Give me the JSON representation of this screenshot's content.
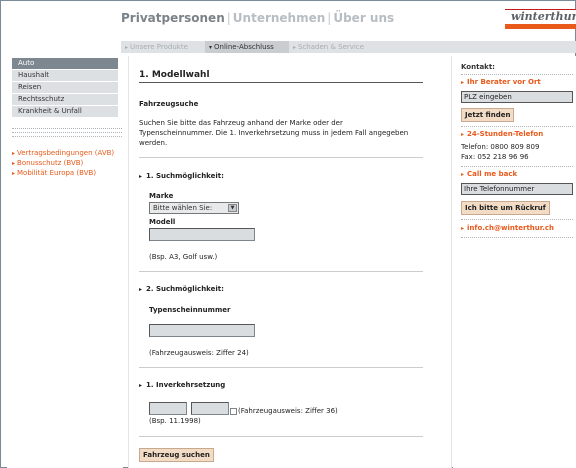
{
  "header": {
    "nav": [
      {
        "label": "Privatpersonen",
        "active": true
      },
      {
        "label": "Unternehmen",
        "active": false
      },
      {
        "label": "Über uns",
        "active": false
      }
    ],
    "separator": "|",
    "logo_text": "winterthur"
  },
  "subnav": {
    "tabs": [
      {
        "label": "Unsere Produkte",
        "active": false
      },
      {
        "label": "Online-Abschluss",
        "active": true
      },
      {
        "label": "Schaden & Service",
        "active": false
      }
    ]
  },
  "sidebar": {
    "items": [
      {
        "label": "Auto",
        "active": true
      },
      {
        "label": "Haushalt",
        "active": false
      },
      {
        "label": "Reisen",
        "active": false
      },
      {
        "label": "Rechtsschutz",
        "active": false
      },
      {
        "label": "Krankheit & Unfall",
        "active": false
      }
    ],
    "links": [
      {
        "label": "Vertragsbedingungen (AVB)"
      },
      {
        "label": "Bonusschutz (BVB)"
      },
      {
        "label": "Mobilität Europa (BVB)"
      }
    ]
  },
  "main": {
    "title": "1. Modellwahl",
    "subtitle": "Fahrzeugsuche",
    "intro": "Suchen Sie bitte das Fahrzeug anhand der Marke oder der Typenscheinnummer. Die 1. Inverkehrsetzung muss in jedem Fall angegeben werden.",
    "section1": {
      "heading": "1. Suchmöglichkeit:",
      "marke_label": "Marke",
      "marke_value": "Bitte wählen Sie:",
      "modell_label": "Modell",
      "modell_value": "",
      "example": "(Bsp. A3, Golf usw.)"
    },
    "section2": {
      "heading": "2. Suchmöglichkeit:",
      "typenschein_label": "Typenscheinnummer",
      "typenschein_value": "",
      "note": "(Fahrzeugausweis: Ziffer 24)"
    },
    "section3": {
      "heading": "1. Inverkehrsetzung",
      "month_value": "",
      "year_value": "",
      "note": "(Fahrzeugausweis: Ziffer 36)",
      "example": "(Bsp. 11.1998)"
    },
    "submit_label": "Fahrzeug suchen"
  },
  "right": {
    "kontakt_label": "Kontakt:",
    "berater_heading": "Ihr Berater vor Ort",
    "plz_placeholder": "PLZ eingeben",
    "find_button": "Jetzt finden",
    "phone_heading": "24-Stunden-Telefon",
    "telefon_line": "Telefon: 0800 809 809",
    "fax_line": "Fax: 052 218 96 96",
    "callme_heading": "Call me back",
    "phone_placeholder": "Ihre Telefonnummer",
    "callback_button": "Ich bitte um Rückruf",
    "email_link": "info.ch@winterthur.ch"
  },
  "colors": {
    "accent": "#e8591a",
    "brand_red": "#c4161c",
    "active_menu": "#7d8790",
    "button_bg": "#f3dcc6"
  },
  "icons": [
    "arrow-right-icon",
    "triangle-right-icon",
    "dropdown-arrow-icon"
  ]
}
